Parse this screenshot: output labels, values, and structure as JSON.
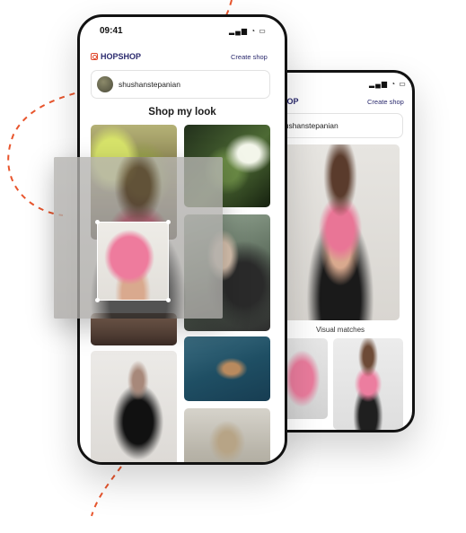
{
  "front_phone": {
    "status_time": "09:41",
    "status_icons": "▂▄▆ ◔ ▭",
    "brand": "HOPSHOP",
    "create_shop": "Create shop",
    "username": "shushanstepanian",
    "section_title": "Shop my look",
    "tiles": [
      "plant-photo",
      "tunnel-photo",
      "car-photo",
      "pool-photo",
      "mirror-photo",
      "black-dress-photo"
    ]
  },
  "back_phone": {
    "status_icons": "▂▄▆ ◔ ▭",
    "brand_partial": "HOP",
    "create_shop": "Create shop",
    "username_partial": "hushanstepanian",
    "visual_matches": "Visual matches"
  },
  "colors": {
    "accent_dashed": "#e8552d",
    "brand": "#2b2a6e",
    "highlight_pink": "#ee7b9d"
  }
}
